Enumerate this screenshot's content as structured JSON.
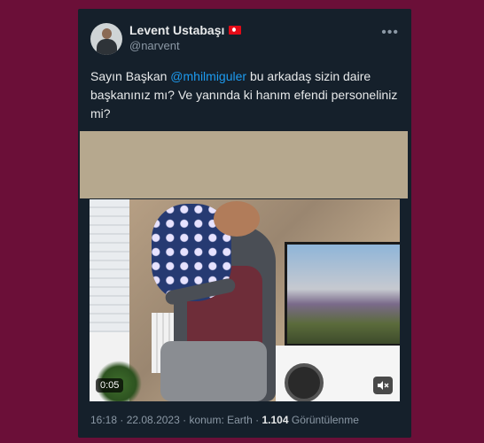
{
  "author": {
    "display_name": "Levent Ustabaşı",
    "handle": "@narvent",
    "flag_icon": "turkey-flag-icon"
  },
  "more_icon": "more-horizontal-icon",
  "tweet": {
    "text_before": "Sayın Başkan ",
    "mention": "@mhilmiguler",
    "text_after": " bu arkadaş sizin daire başkanınız mı? Ve yanında ki hanım efendi personeliniz mi?"
  },
  "video": {
    "elapsed": "0:05",
    "mute_icon": "speaker-muted-icon"
  },
  "meta": {
    "time": "16:18",
    "date": "22.08.2023",
    "location": "konum: Earth",
    "views_count": "1.104",
    "views_label": "Görüntülenme"
  },
  "colors": {
    "background": "#6b0f38",
    "card": "#15202b",
    "accent": "#1d9bf0",
    "redaction": "#b6a88e"
  }
}
